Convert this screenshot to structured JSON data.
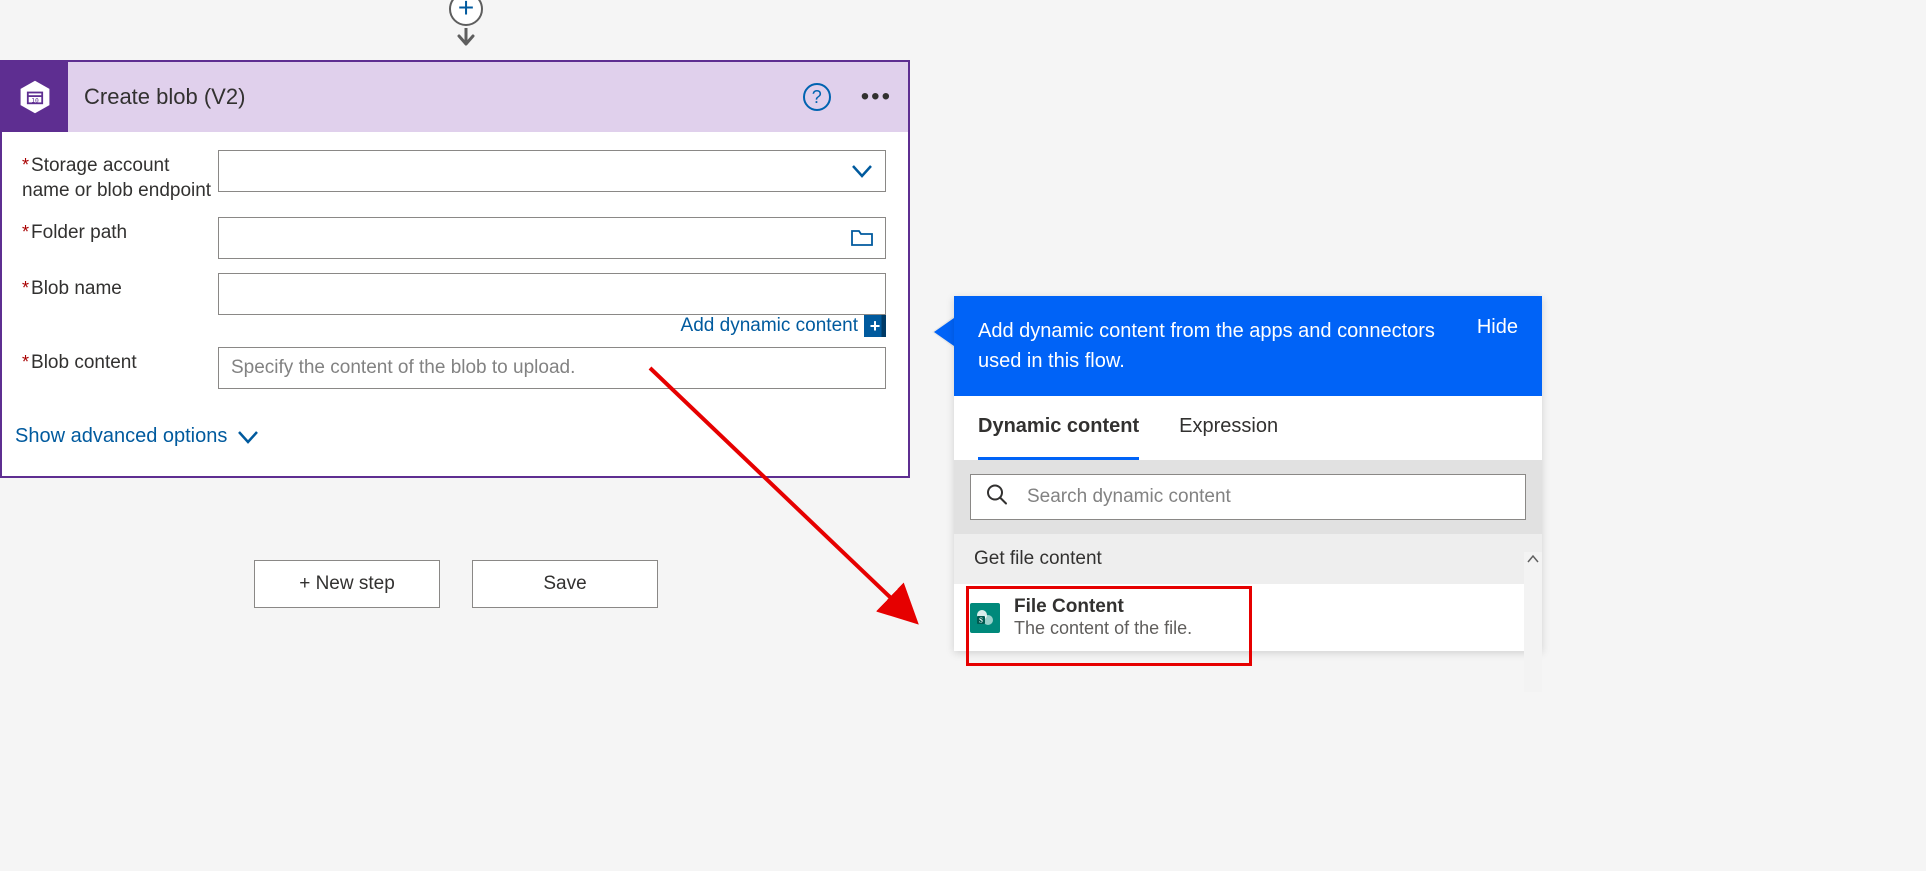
{
  "card": {
    "title": "Create blob (V2)",
    "fields": {
      "storage": {
        "label": "Storage account name or blob endpoint"
      },
      "folder": {
        "label": "Folder path"
      },
      "blobname": {
        "label": "Blob name"
      },
      "content": {
        "label": "Blob content",
        "placeholder": "Specify the content of the blob to upload."
      }
    },
    "dynamic_link": "Add dynamic content",
    "advanced": "Show advanced options"
  },
  "footer": {
    "newstep": "+ New step",
    "save": "Save"
  },
  "panel": {
    "header_text": "Add dynamic content from the apps and connectors used in this flow.",
    "hide": "Hide",
    "tabs": {
      "dynamic": "Dynamic content",
      "expression": "Expression"
    },
    "search_placeholder": "Search dynamic content",
    "section": "Get file content",
    "item": {
      "title": "File Content",
      "desc": "The content of the file."
    }
  }
}
